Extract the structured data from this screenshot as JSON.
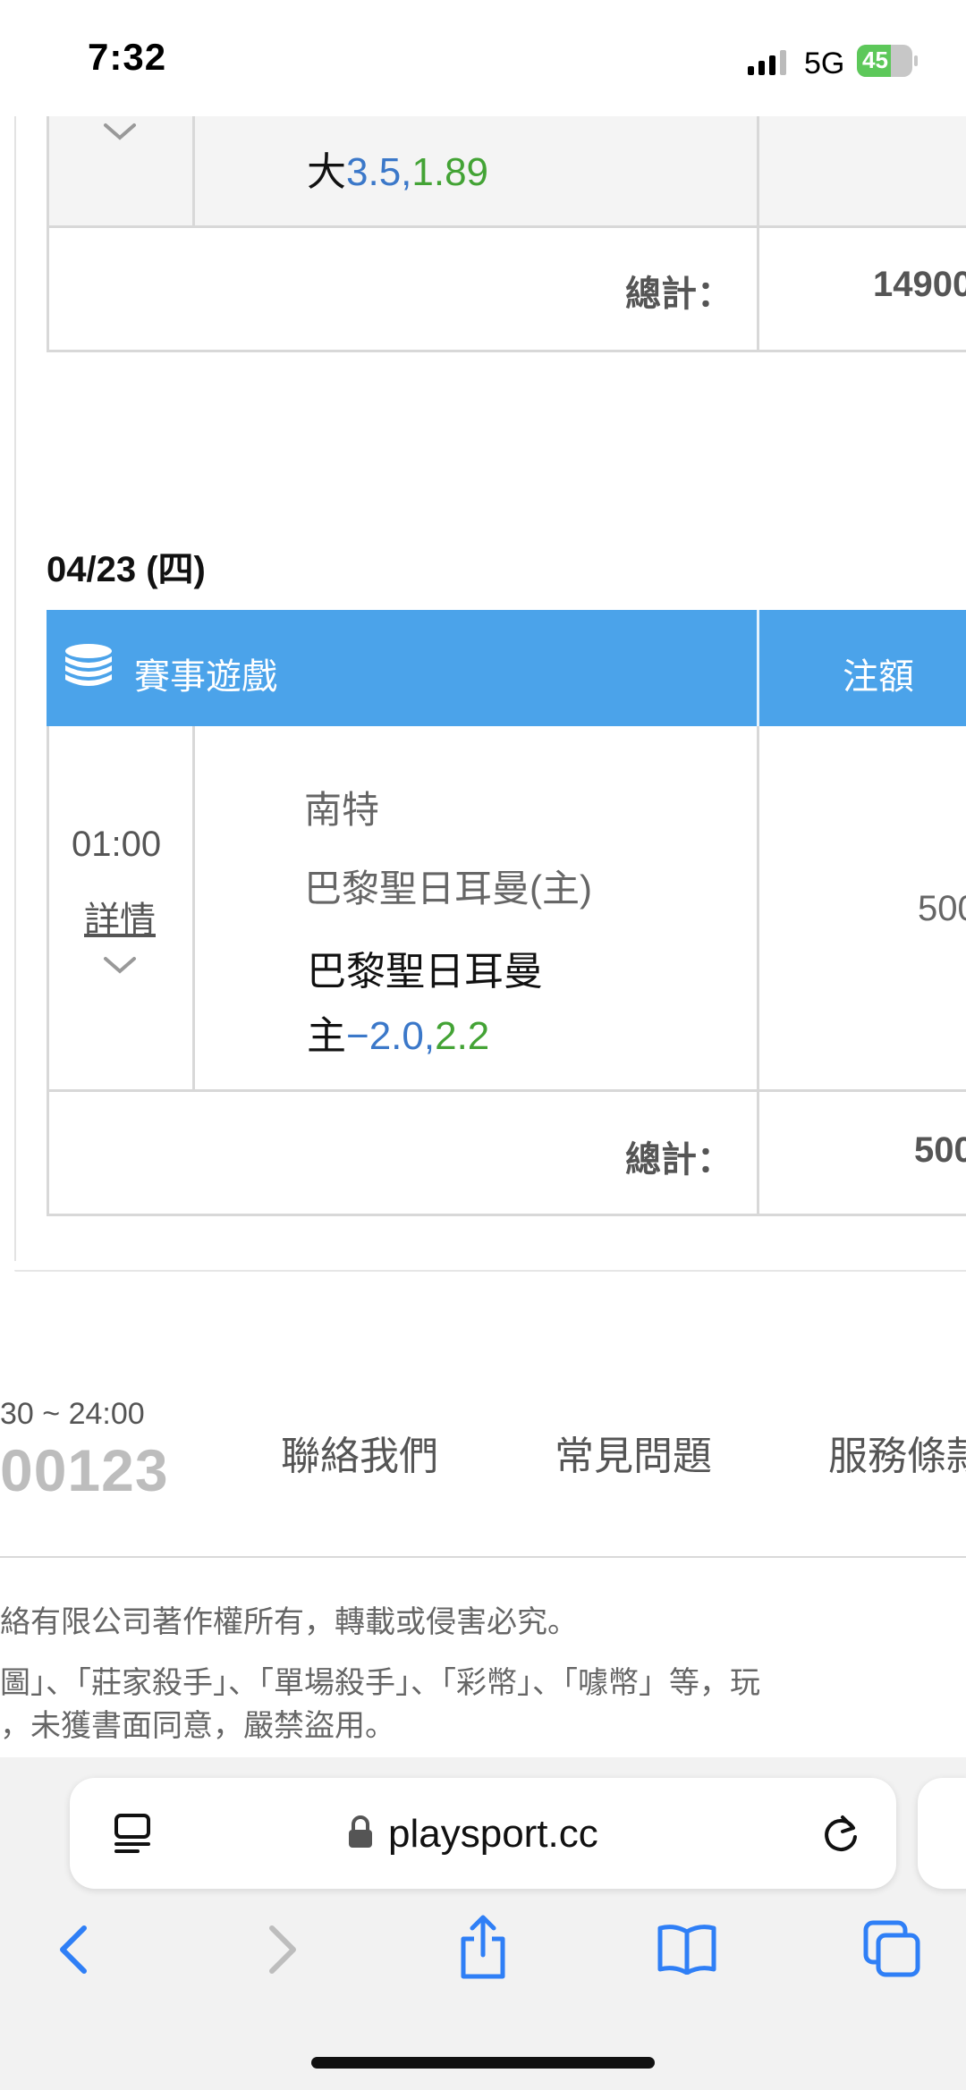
{
  "status_bar": {
    "time": "7:32",
    "network": "5G",
    "battery": "45"
  },
  "previous_block": {
    "bet_prefix": "大",
    "bet_line": "3.5,",
    "bet_odds": "1.89",
    "total_label": "總計：",
    "total_value": "14900"
  },
  "section": {
    "date": "04/23 (四)",
    "header_title": "賽事遊戲",
    "header_amount": "注額",
    "game": {
      "time": "01:00",
      "details_link": "詳情",
      "away_team": "南特",
      "home_team": "巴黎聖日耳曼(主)",
      "pick_team": "巴黎聖日耳曼",
      "pick_prefix": "主",
      "pick_line": "−2.0,",
      "pick_odds": "2.2",
      "amount": "500"
    },
    "total_label": "總計：",
    "total_value": "500"
  },
  "footer": {
    "hours": "30 ~ 24:00",
    "phone": "00123",
    "links": [
      "聯絡我們",
      "常見問題",
      "服務條款"
    ],
    "copyright": "絡有限公司著作權所有，轉載或侵害必究。",
    "trademark_line1": "圖」、「莊家殺手」、「單場殺手」、「彩幣」、「噱幣」等，玩",
    "trademark_line2": "，未獲書面同意，嚴禁盜用。"
  },
  "browser": {
    "url": "playsport.cc"
  }
}
